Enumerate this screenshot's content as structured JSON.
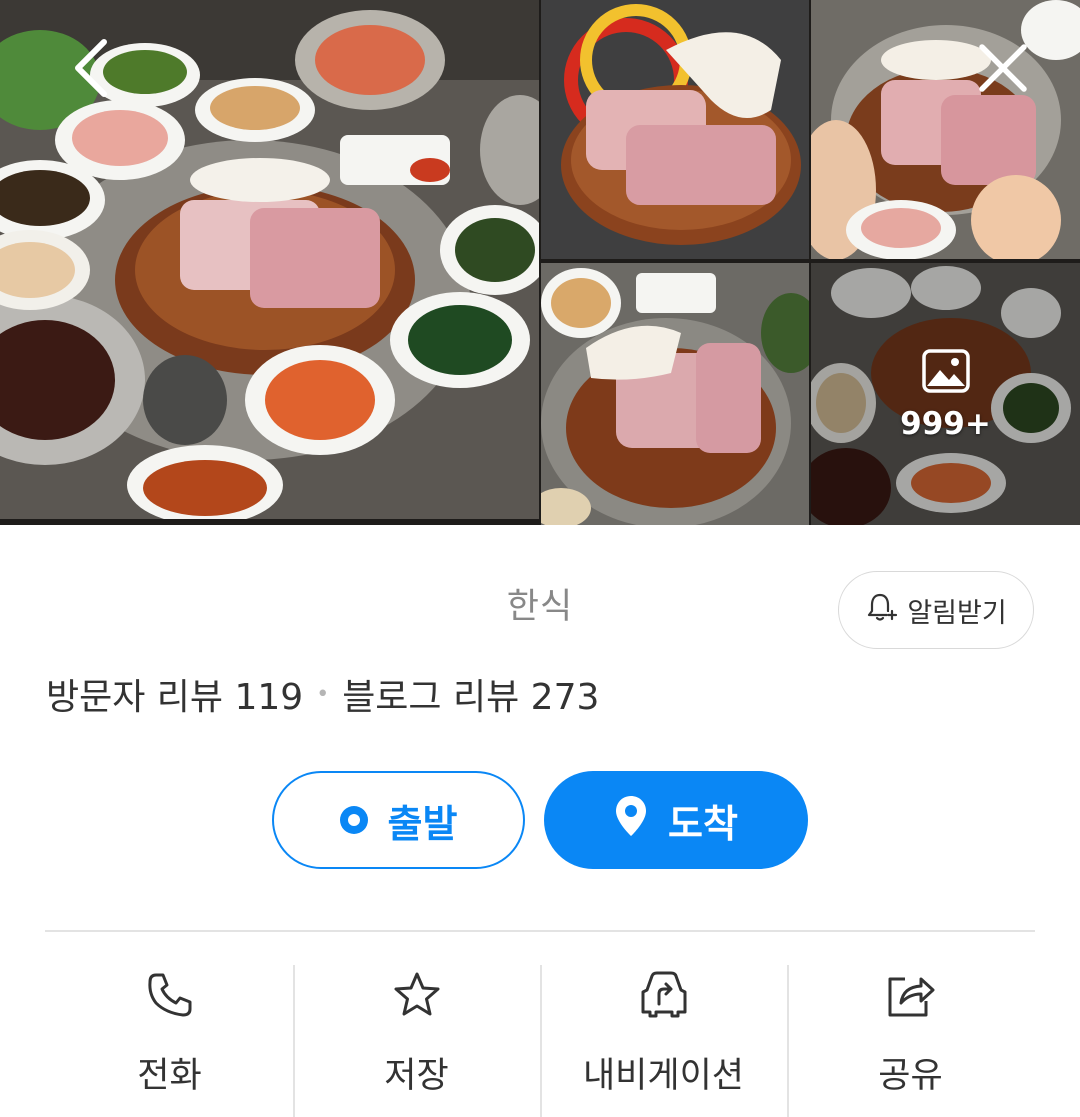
{
  "gallery": {
    "more_count": "999+",
    "icons": {
      "back": "chevron-left-icon",
      "close": "close-icon",
      "more": "image-icon"
    }
  },
  "place": {
    "category": "한식",
    "alarm_label": "알림받기",
    "visitor_reviews": "방문자 리뷰 119",
    "review_separator": "•",
    "blog_reviews": "블로그 리뷰 273"
  },
  "route": {
    "start_label": "출발",
    "arrive_label": "도착"
  },
  "actions": [
    {
      "label": "전화",
      "icon": "phone-icon"
    },
    {
      "label": "저장",
      "icon": "star-icon"
    },
    {
      "label": "내비게이션",
      "icon": "car-navigation-icon"
    },
    {
      "label": "공유",
      "icon": "share-icon"
    }
  ],
  "colors": {
    "accent": "#0a87f5",
    "text": "#333333",
    "muted": "#888888",
    "border": "#e3e3e3"
  }
}
